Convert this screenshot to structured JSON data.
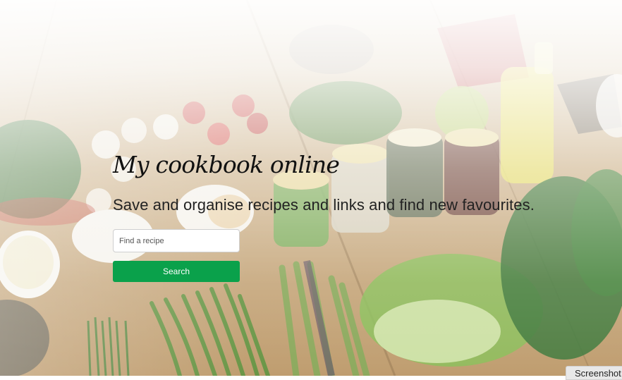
{
  "hero": {
    "title": "My cookbook online",
    "subtitle": "Save and organise recipes and links and find new favourites.",
    "background_image": "vegetables-and-jars-on-wooden-table"
  },
  "search": {
    "placeholder": "Find a recipe",
    "value": "",
    "button_label": "Search"
  },
  "screenshot_tab": {
    "label": "Screenshot"
  },
  "colors": {
    "accent": "#0aa14b",
    "title_text": "#111111",
    "subtitle_text": "#222222"
  }
}
